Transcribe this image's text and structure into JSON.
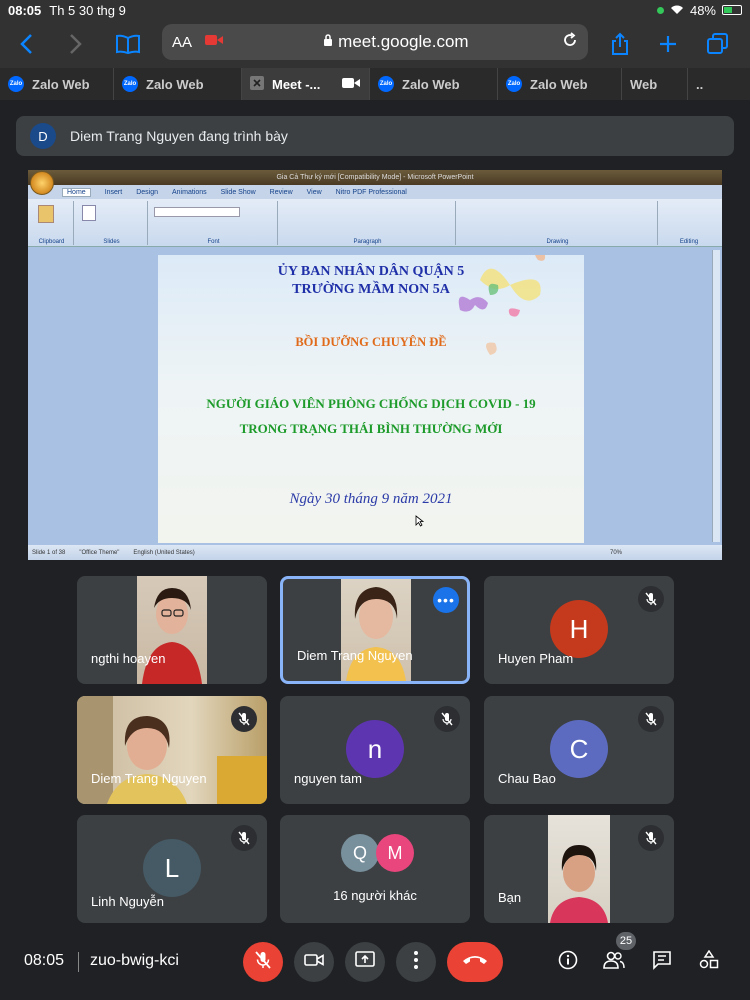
{
  "status_bar": {
    "time": "08:05",
    "date": "Th 5 30 thg 9",
    "battery": "48%"
  },
  "browser": {
    "text_size_label": "AA",
    "url": "meet.google.com"
  },
  "tabs": [
    {
      "label": "Zalo Web"
    },
    {
      "label": "Zalo Web"
    },
    {
      "label": "Meet -..."
    },
    {
      "label": "Zalo Web"
    },
    {
      "label": "Zalo Web"
    },
    {
      "label": "Web"
    },
    {
      "label": ".."
    }
  ],
  "presenting": {
    "initial": "D",
    "text": "Diem Trang Nguyen đang trình bày"
  },
  "ppt": {
    "window_title": "Gia Cả Thư ký mới [Compatibility Mode] - Microsoft PowerPoint",
    "ribbon_tabs": [
      "Home",
      "Insert",
      "Design",
      "Animations",
      "Slide Show",
      "Review",
      "View",
      "Nitro PDF Professional"
    ],
    "groups": [
      "Clipboard",
      "Slides",
      "Font",
      "Paragraph",
      "Drawing",
      "Editing"
    ],
    "status_slide": "Slide 1 of 38",
    "status_theme": "\"Office Theme\"",
    "status_lang": "English (United States)",
    "zoom": "70%"
  },
  "slide": {
    "line1": "ỦY BAN NHÂN DÂN QUẬN 5",
    "line2": "TRƯỜNG MẦM NON 5A",
    "line3": "BỒI DƯỠNG CHUYÊN ĐỀ",
    "line4": "NGƯỜI GIÁO VIÊN PHÒNG CHỐNG DỊCH COVID - 19",
    "line5": "TRONG TRẠNG THÁI BÌNH THƯỜNG MỚI",
    "date": "Ngày 30 tháng 9 năm 2021"
  },
  "participants": [
    {
      "name": "ngthi hoayen"
    },
    {
      "name": "Diem Trang Nguyen"
    },
    {
      "name": "Huyen Pham",
      "initial": "H",
      "color": "#c5391c"
    },
    {
      "name": "Diem Trang Nguyen"
    },
    {
      "name": "nguyen tam",
      "initial": "n",
      "color": "#5e35b1"
    },
    {
      "name": "Chau Bao",
      "initial": "C",
      "color": "#5c6bc0"
    },
    {
      "name": "Linh Nguyễn",
      "initial": "L",
      "color": "#455a64"
    },
    {
      "name": "16 người khác",
      "initials": [
        "Q",
        "M"
      ],
      "colors": [
        "#78909c",
        "#e8467c"
      ]
    },
    {
      "name": "Bạn"
    }
  ],
  "bottom_bar": {
    "time": "08:05",
    "meeting_code": "zuo-bwig-kci",
    "people_count": "25"
  },
  "colors": {
    "accent": "#1a73e8",
    "hangup": "#ea4335",
    "tile": "#3c4043"
  }
}
